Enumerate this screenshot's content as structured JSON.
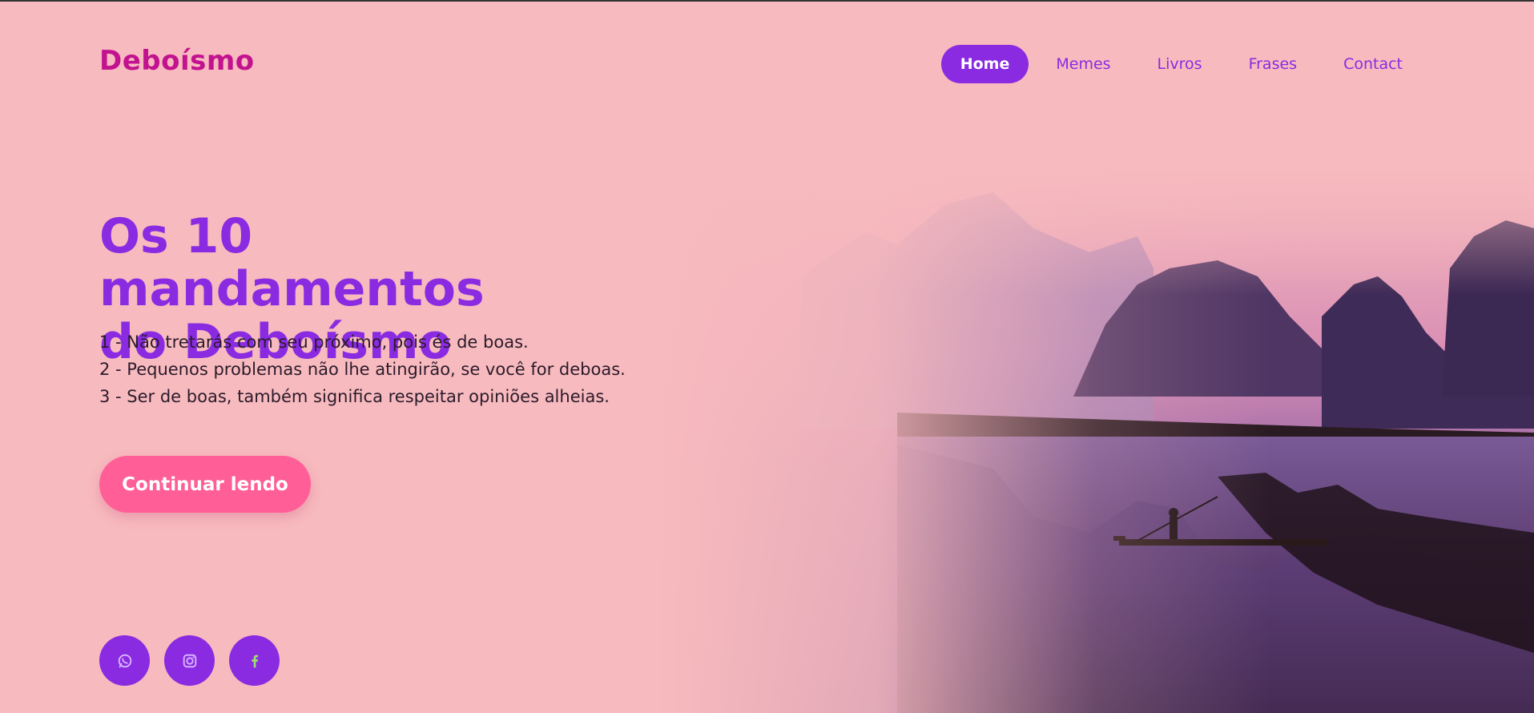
{
  "brand": {
    "name": "Deboísmo"
  },
  "nav": {
    "items": [
      {
        "label": "Home",
        "active": true
      },
      {
        "label": "Memes",
        "active": false
      },
      {
        "label": "Livros",
        "active": false
      },
      {
        "label": "Frases",
        "active": false
      },
      {
        "label": "Contact",
        "active": false
      }
    ]
  },
  "hero": {
    "title_line1": "Os 10 mandamentos",
    "title_line2": "do Deboísmo",
    "commandments": [
      "1 - Não tretarás com seu próximo, pois és de boas.",
      "2 - Pequenos problemas não lhe atingirão, se você for deboas.",
      "3 - Ser de boas, também significa respeitar opiniões alheias."
    ],
    "cta_label": "Continuar lendo",
    "image_alt": "mountain-lake-boat-photo"
  },
  "socials": [
    {
      "name": "whatsapp-icon"
    },
    {
      "name": "instagram-icon"
    },
    {
      "name": "facebook-icon"
    }
  ],
  "colors": {
    "background": "#f7babe",
    "accent": "#8a2be2",
    "brand": "#c2128f",
    "cta": "#ff5f96"
  }
}
